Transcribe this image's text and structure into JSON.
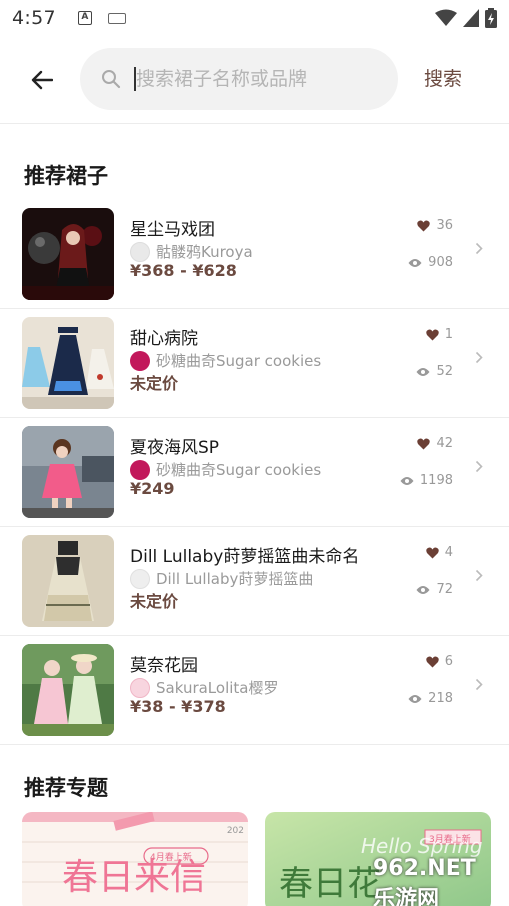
{
  "status_bar": {
    "time": "4:57",
    "notif_icon_a": "A"
  },
  "search": {
    "placeholder": "搜索裙子名称或品牌",
    "submit_label": "搜索"
  },
  "sections": {
    "recommended_skirts": "推荐裙子",
    "recommended_topics": "推荐专题"
  },
  "items": [
    {
      "name": "星尘马戏团",
      "brand": "骷髅鸦Kuroya",
      "price": "¥368 - ¥628",
      "likes": "36",
      "views": "908",
      "logo_color": "#d9d9d9"
    },
    {
      "name": "甜心病院",
      "brand": "砂糖曲奇Sugar cookies",
      "price": "未定价",
      "likes": "1",
      "views": "52",
      "logo_color": "#c2185b"
    },
    {
      "name": "夏夜海风SP",
      "brand": "砂糖曲奇Sugar cookies",
      "price": "¥249",
      "likes": "42",
      "views": "1198",
      "logo_color": "#c2185b"
    },
    {
      "name": "Dill Lullaby莳萝摇篮曲未命名",
      "brand": "Dill Lullaby莳萝摇篮曲",
      "price": "未定价",
      "likes": "4",
      "views": "72",
      "logo_color": "#e0e0e0"
    },
    {
      "name": "莫奈花园",
      "brand": "SakuraLolita樱罗",
      "price": "¥38 - ¥378",
      "likes": "6",
      "views": "218",
      "logo_color": "#f8bbd0"
    }
  ],
  "topics": [
    {
      "title": "春日来信",
      "tag": "4月春上新",
      "year": "202"
    },
    {
      "title": "春日花",
      "tag": "3月春上新",
      "subtitle": "Hello Spring",
      "watermark": "962.NET 乐游网"
    }
  ],
  "colors": {
    "accent": "#6b4a40",
    "heart": "#6b3f35",
    "muted": "#9a9a9a",
    "search_bg": "#f2f2f2"
  },
  "icons": {
    "back": "arrow-left-icon",
    "search": "search-icon",
    "like": "heart-icon",
    "view": "eye-icon",
    "more": "chevron-right-icon"
  }
}
